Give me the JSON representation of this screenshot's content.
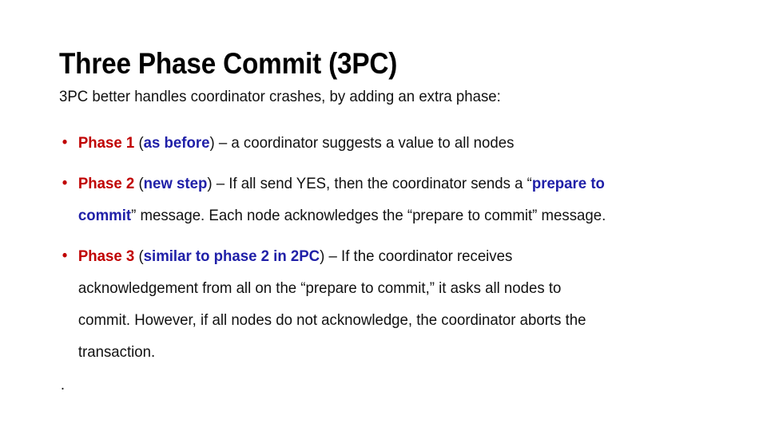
{
  "slide": {
    "title": "Three Phase Commit (3PC)",
    "background_color": "#FFFFFF",
    "accent_colors": {
      "phase_label_red": "#C00000",
      "annotation_blue": "#2020A8",
      "body_black": "#111111"
    },
    "intro": "3PC better handles coordinator crashes, by adding an extra phase:",
    "bullets": [
      {
        "marker": "•",
        "marker_color": "#C00000",
        "runs": [
          {
            "text": "Phase 1",
            "style": "red-bold"
          },
          {
            "text": " (",
            "style": "black"
          },
          {
            "text": "as before",
            "style": "blue-bold"
          },
          {
            "text": ") – a coordinator suggests a value to all nodes",
            "style": "black"
          }
        ]
      },
      {
        "marker": "•",
        "marker_color": "#C00000",
        "runs": [
          {
            "text": "Phase 2",
            "style": "red-bold"
          },
          {
            "text": " (",
            "style": "black"
          },
          {
            "text": "new step",
            "style": "blue-bold"
          },
          {
            "text": ") – If all send YES, then the coordinator sends a “",
            "style": "black"
          },
          {
            "text": "prepare to commit",
            "style": "blue-bold"
          },
          {
            "text": "” message. Each node acknowledges the “prepare to commit” message.",
            "style": "black"
          }
        ]
      },
      {
        "marker": "•",
        "marker_color": "#C00000",
        "runs": [
          {
            "text": "Phase 3",
            "style": "red-bold"
          },
          {
            "text": " (",
            "style": "black"
          },
          {
            "text": "similar to phase 2 in 2PC",
            "style": "blue-bold"
          },
          {
            "text": ") – If the coordinator receives acknowledgement from all on the “prepare to commit,” it asks all nodes to commit. However, if all nodes do not acknowledge, the coordinator aborts the transaction.",
            "style": "black"
          }
        ]
      }
    ],
    "trailing_text": ".",
    "rendered_lines": {
      "bullet1": [
        [
          {
            "text": "Phase 1",
            "style": "red-bold"
          },
          {
            "text": " (",
            "style": "black"
          },
          {
            "text": "as before",
            "style": "blue-bold"
          },
          {
            "text": ") – a coordinator suggests a value to all nodes",
            "style": "black"
          }
        ]
      ],
      "bullet2": [
        [
          {
            "text": "Phase 2",
            "style": "red-bold"
          },
          {
            "text": " (",
            "style": "black"
          },
          {
            "text": "new step",
            "style": "blue-bold"
          },
          {
            "text": ") – If all send YES, then the coordinator sends a “",
            "style": "black"
          },
          {
            "text": "prepare to",
            "style": "blue-bold"
          }
        ],
        [
          {
            "text": "commit",
            "style": "blue-bold"
          },
          {
            "text": "” message. Each node acknowledges the “prepare to commit” message.",
            "style": "black"
          }
        ]
      ],
      "bullet3": [
        [
          {
            "text": "Phase 3",
            "style": "red-bold"
          },
          {
            "text": " (",
            "style": "black"
          },
          {
            "text": "similar to phase 2 in 2PC",
            "style": "blue-bold"
          },
          {
            "text": ") – If the coordinator receives",
            "style": "black"
          }
        ],
        [
          {
            "text": "acknowledgement from all on the “prepare to commit,” it asks all nodes to",
            "style": "black"
          }
        ],
        [
          {
            "text": "commit. However, if all nodes do not acknowledge, the coordinator aborts the",
            "style": "black"
          }
        ],
        [
          {
            "text": "transaction.",
            "style": "black"
          }
        ]
      ]
    }
  }
}
